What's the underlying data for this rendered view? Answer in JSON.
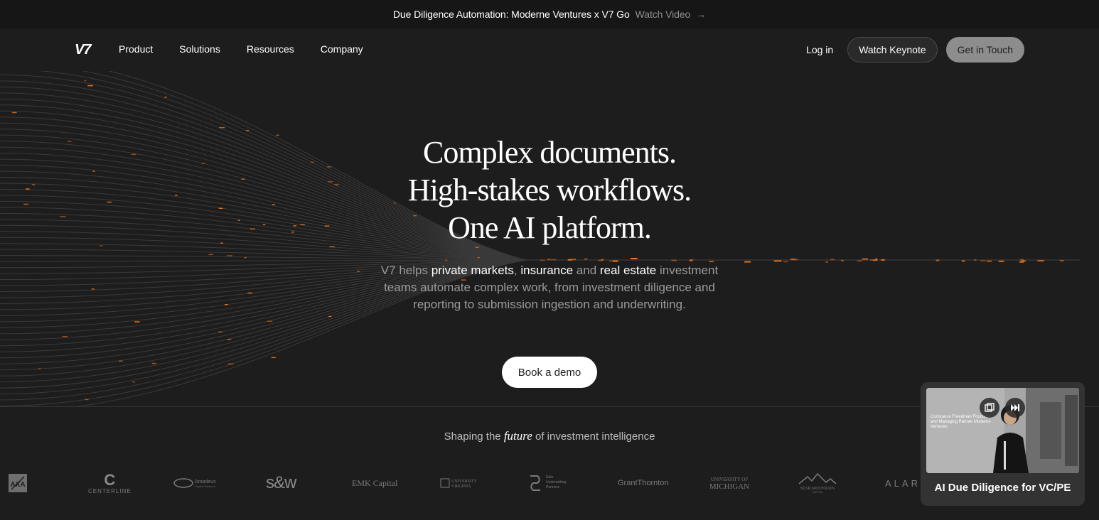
{
  "announcement": {
    "text": "Due Diligence Automation: Moderne Ventures x V7 Go",
    "link": "Watch Video",
    "arrow": "→"
  },
  "nav": {
    "logo": "V7",
    "items": [
      "Product",
      "Solutions",
      "Resources",
      "Company"
    ],
    "login": "Log in",
    "keynote": "Watch Keynote",
    "contact": "Get in Touch"
  },
  "hero": {
    "title_lines": [
      "Complex documents.",
      "High-stakes workflows.",
      "One AI platform."
    ],
    "sub": {
      "p1": "V7 helps ",
      "h1": "private markets",
      "p2": ", ",
      "h2": "insurance",
      "p3": " and ",
      "h3": "real estate",
      "p4": " investment teams automate complex work, from investment diligence and reporting to submission ingestion and underwriting."
    },
    "cta": "Book a demo"
  },
  "logos_section": {
    "tagline_pre": "Shaping the ",
    "tagline_em": "future",
    "tagline_post": " of investment intelligence",
    "logos": [
      {
        "name": "AXA",
        "icon": "axa-logo"
      },
      {
        "name": "CENTERLINE",
        "icon": "centerline-logo"
      },
      {
        "name": "Amadeus Capital Partners",
        "icon": "amadeus-logo"
      },
      {
        "name": "s&w",
        "icon": "sw-logo"
      },
      {
        "name": "EMK Capital",
        "icon": "emk-logo"
      },
      {
        "name": "University of Virginia",
        "icon": "uva-logo"
      },
      {
        "name": "Dale Underwriting Partners",
        "icon": "dale-logo"
      },
      {
        "name": "GrantThornton",
        "icon": "grantthornton-logo"
      },
      {
        "name": "UNIVERSITY OF MICHIGAN",
        "icon": "umich-logo"
      },
      {
        "name": "STAR MOUNTAIN CAPITAL",
        "icon": "starmountain-logo"
      },
      {
        "name": "ALARI",
        "icon": "alari-logo"
      }
    ]
  },
  "video_popup": {
    "caption": "AI Due Diligence for VC/PE",
    "overlay_text": "Constance Freedman Founder and Managing Partner Moderne Ventures"
  },
  "colors": {
    "background": "#1d1d1d",
    "announcement_bg": "#161616",
    "accent_spark": "#e8731e",
    "button_light": "#ffffff",
    "button_grey": "#8d8d8d"
  }
}
